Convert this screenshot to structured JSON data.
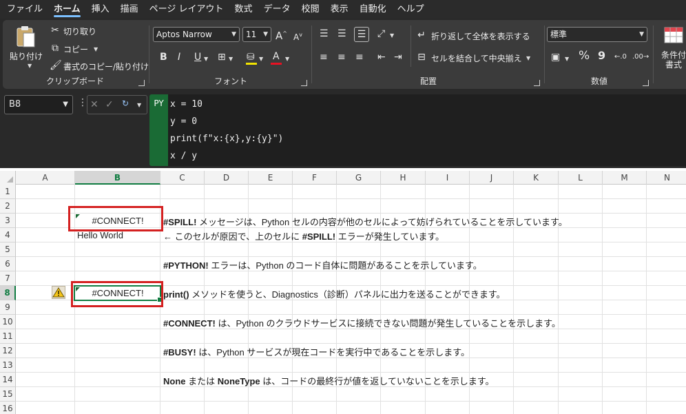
{
  "menu": [
    "ファイル",
    "ホーム",
    "挿入",
    "描画",
    "ページ レイアウト",
    "数式",
    "データ",
    "校閲",
    "表示",
    "自動化",
    "ヘルプ"
  ],
  "menu_active_index": 1,
  "ribbon": {
    "clipboard": {
      "paste": "貼り付け",
      "cut": "切り取り",
      "copy": "コピー",
      "format_painter": "書式のコピー/貼り付け",
      "label": "クリップボード"
    },
    "font": {
      "name": "Aptos Narrow",
      "size": "11",
      "label": "フォント",
      "bold": "B",
      "italic": "I",
      "underline": "U",
      "grow": "A",
      "shrink": "A",
      "font_color": "A"
    },
    "alignment": {
      "wrap": "折り返して全体を表示する",
      "merge": "セルを結合して中央揃え",
      "label": "配置"
    },
    "number": {
      "format": "標準",
      "percent": "%",
      "comma": "9",
      "label": "数値"
    },
    "styles": {
      "conditional_line1": "条件付き",
      "conditional_line2": "書式"
    }
  },
  "formula_bar": {
    "name_box": "B8",
    "badge": "PY",
    "code": [
      "x = 10",
      "y = 0",
      "print(f\"x:{x},y:{y}\")",
      "x / y"
    ]
  },
  "columns": [
    "A",
    "B",
    "C",
    "D",
    "E",
    "F",
    "G",
    "H",
    "I",
    "J",
    "K",
    "L",
    "M",
    "N"
  ],
  "rows": [
    "1",
    "2",
    "3",
    "4",
    "5",
    "6",
    "7",
    "8",
    "9",
    "10",
    "11",
    "12",
    "13",
    "14",
    "15",
    "16"
  ],
  "selected_cell": {
    "column": "B",
    "row": "8"
  },
  "cells": {
    "B3": "#CONNECT!",
    "B4": "Hello World",
    "B8": "#CONNECT!",
    "C3": {
      "bold": "#SPILL!",
      "rest": " メッセージは、Python セルの内容が他のセルによって妨げられていることを示しています。"
    },
    "C4": {
      "pre": "← このセルが原因で、上のセルに ",
      "bold": "#SPILL!",
      "rest": " エラーが発生しています。"
    },
    "C6": {
      "bold": "#PYTHON!",
      "rest": " エラーは、Python のコード自体に問題があることを示しています。"
    },
    "C8": {
      "bold": "print()",
      "rest": " メソッドを使うと、Diagnostics（診断）パネルに出力を送ることができます。"
    },
    "C10": {
      "bold": "#CONNECT!",
      "rest": " は、Python のクラウドサービスに接続できない問題が発生していることを示します。"
    },
    "C12": {
      "bold": "#BUSY!",
      "rest": " は、Python サービスが現在コードを実行中であることを示します。"
    },
    "C14": {
      "bold1": "None",
      "mid": " または ",
      "bold2": "NoneType",
      "rest": " は、コードの最終行が値を返していないことを示します。"
    }
  },
  "colors": {
    "accent_green": "#107c41",
    "highlight_red": "#d42020",
    "python_green": "#1a6b35"
  }
}
